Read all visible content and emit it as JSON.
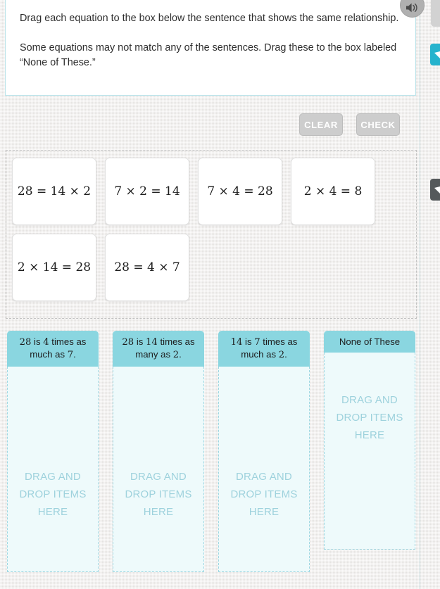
{
  "instructions": {
    "paragraph_1": "Drag each equation to the box below the sentence that shows the same relationship.",
    "paragraph_2": "Some equations may not match any of the sentences. Drag these to the box labeled “None of These.”"
  },
  "toolbar": {
    "clear_label": "CLEAR",
    "check_label": "CHECK",
    "speaker_icon": "speaker-icon"
  },
  "edge_tabs": [
    {
      "name": "help-tab",
      "icon": "chevron-left-icon",
      "color": "#26b3cd"
    },
    {
      "name": "tools-tab",
      "icon": "chevron-left-icon",
      "color": "#55595b"
    }
  ],
  "equations": [
    {
      "text": "28 = 14 × 2"
    },
    {
      "text": "7 × 2 = 14"
    },
    {
      "text": "7 × 4 = 28"
    },
    {
      "text": "2 × 4 = 8"
    },
    {
      "text": "2 × 14 = 28"
    },
    {
      "text": "28 = 4 × 7"
    }
  ],
  "dropzones": [
    {
      "header_parts": [
        {
          "type": "num",
          "text": "28"
        },
        {
          "type": "word",
          "text": " is "
        },
        {
          "type": "num",
          "text": "4"
        },
        {
          "type": "word",
          "text": " times as much as "
        },
        {
          "type": "num",
          "text": "7"
        },
        {
          "type": "word",
          "text": "."
        }
      ],
      "header_text": "28 is 4 times as much as 7.",
      "placeholder": "DRAG AND DROP ITEMS HERE",
      "items": []
    },
    {
      "header_parts": [
        {
          "type": "num",
          "text": "28"
        },
        {
          "type": "word",
          "text": " is "
        },
        {
          "type": "num",
          "text": "14"
        },
        {
          "type": "word",
          "text": " times as many as "
        },
        {
          "type": "num",
          "text": "2"
        },
        {
          "type": "word",
          "text": "."
        }
      ],
      "header_text": "28 is 14 times as many as 2.",
      "placeholder": "DRAG AND DROP ITEMS HERE",
      "items": []
    },
    {
      "header_parts": [
        {
          "type": "num",
          "text": "14"
        },
        {
          "type": "word",
          "text": " is "
        },
        {
          "type": "num",
          "text": "7"
        },
        {
          "type": "word",
          "text": " times as much as "
        },
        {
          "type": "num",
          "text": "2"
        },
        {
          "type": "word",
          "text": "."
        }
      ],
      "header_text": "14 is 7 times as much as 2.",
      "placeholder": "DRAG AND DROP ITEMS HERE",
      "items": []
    },
    {
      "header_parts": [
        {
          "type": "word",
          "text": "None of These"
        }
      ],
      "header_text": "None of These",
      "placeholder": "DRAG AND DROP ITEMS HERE",
      "items": []
    }
  ],
  "colors": {
    "header_teal": "#8ad6e0",
    "dropzone_fill": "#eefafb",
    "dropzone_border": "#9dd7e2",
    "placeholder_text": "#9ed2dd",
    "panel_border": "#b9e2e8",
    "button_fill": "#cdcdcd",
    "help_tab": "#26b3cd",
    "tools_tab": "#55595b",
    "page_background": "#eceae8"
  }
}
